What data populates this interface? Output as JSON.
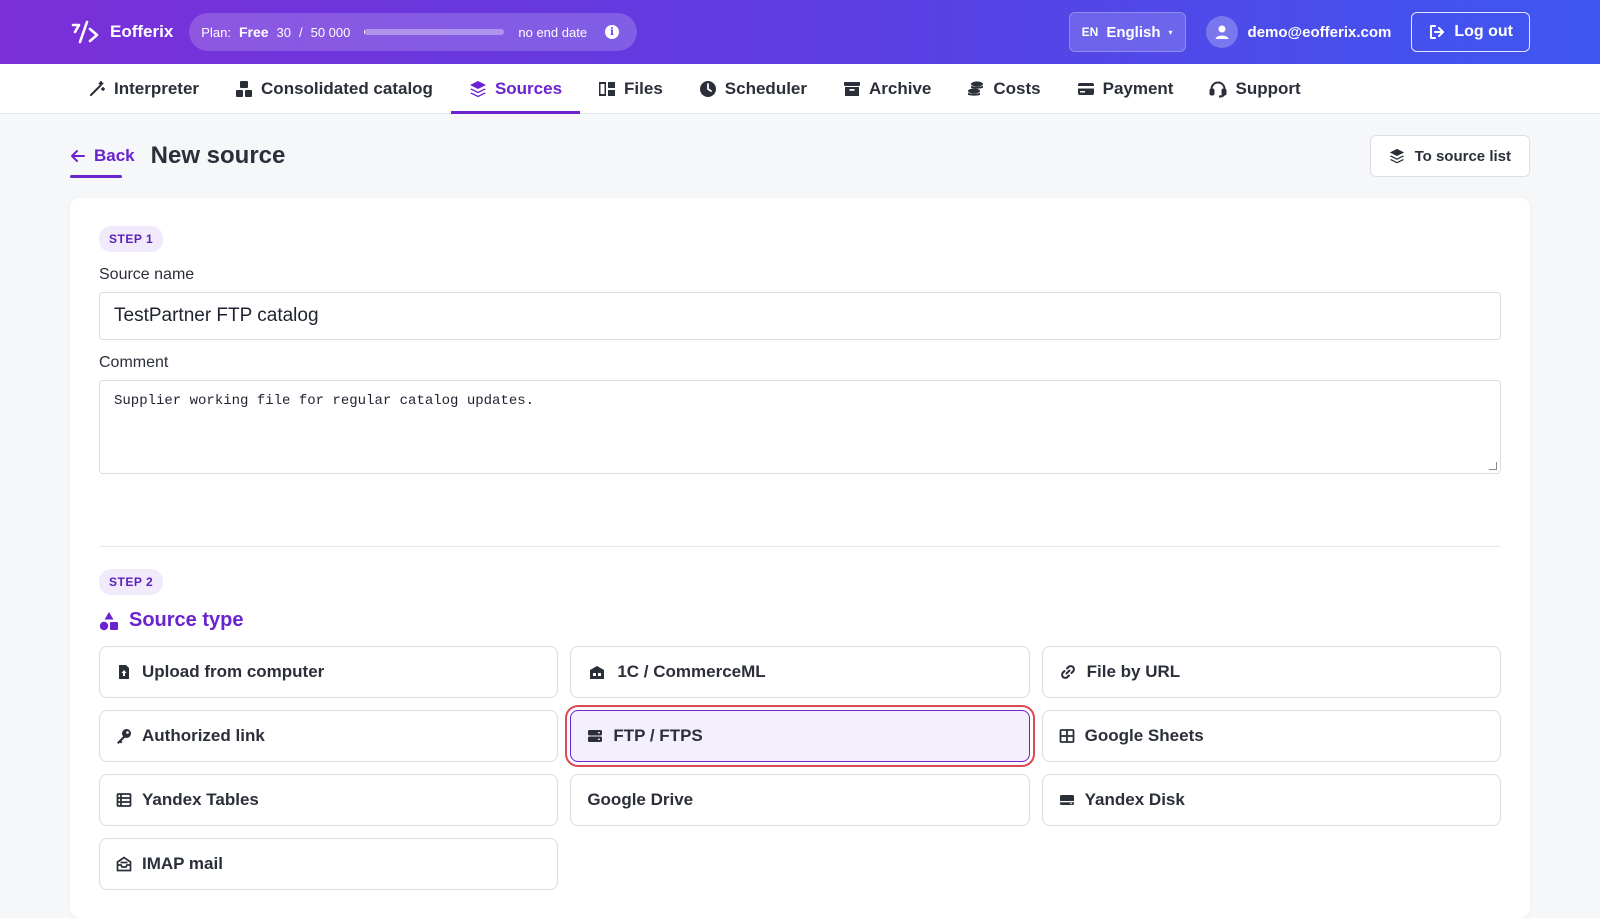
{
  "brand": {
    "name": "Eofferix"
  },
  "plan": {
    "label": "Plan:",
    "name": "Free",
    "usage": "30",
    "separator": "/",
    "limit": "50 000",
    "usage_fraction": 0.0006,
    "end_text": "no end date",
    "info_icon": "info-icon"
  },
  "language": {
    "code": "EN",
    "name": "English",
    "caret": "▾"
  },
  "user": {
    "email": "demo@eofferix.com"
  },
  "logout": {
    "label": "Log out"
  },
  "nav": {
    "items": [
      {
        "label": "Interpreter",
        "icon": "magic-wand-icon"
      },
      {
        "label": "Consolidated catalog",
        "icon": "boxes-icon"
      },
      {
        "label": "Sources",
        "icon": "layers-icon",
        "active": true
      },
      {
        "label": "Files",
        "icon": "files-icon"
      },
      {
        "label": "Scheduler",
        "icon": "clock-icon"
      },
      {
        "label": "Archive",
        "icon": "archive-icon"
      },
      {
        "label": "Costs",
        "icon": "coins-icon"
      },
      {
        "label": "Payment",
        "icon": "credit-card-icon"
      },
      {
        "label": "Support",
        "icon": "headset-icon"
      }
    ]
  },
  "page": {
    "back_label": "Back",
    "title": "New source",
    "to_list_label": "To source list"
  },
  "step1": {
    "badge": "STEP 1",
    "name_label": "Source name",
    "name_value": "TestPartner FTP catalog",
    "comment_label": "Comment",
    "comment_value": "Supplier working file for regular catalog updates."
  },
  "step2": {
    "badge": "STEP 2",
    "title": "Source type",
    "types": [
      {
        "label": "Upload from computer",
        "icon": "file-upload-icon"
      },
      {
        "label": "1C / CommerceML",
        "icon": "warehouse-icon"
      },
      {
        "label": "File by URL",
        "icon": "link-icon"
      },
      {
        "label": "Authorized link",
        "icon": "key-icon"
      },
      {
        "label": "FTP / FTPS",
        "icon": "server-icon",
        "selected": true
      },
      {
        "label": "Google Sheets",
        "icon": "table-icon"
      },
      {
        "label": "Yandex Tables",
        "icon": "list-table-icon"
      },
      {
        "label": "Google Drive",
        "icon": ""
      },
      {
        "label": "Yandex Disk",
        "icon": "hard-drive-icon"
      },
      {
        "label": "IMAP mail",
        "icon": "mail-inbox-icon"
      }
    ]
  },
  "colors": {
    "accent": "#6b22cf",
    "header_gradient_start": "#7b2fd8",
    "header_gradient_end": "#3e57f0",
    "selection_outline": "#d84a55"
  }
}
